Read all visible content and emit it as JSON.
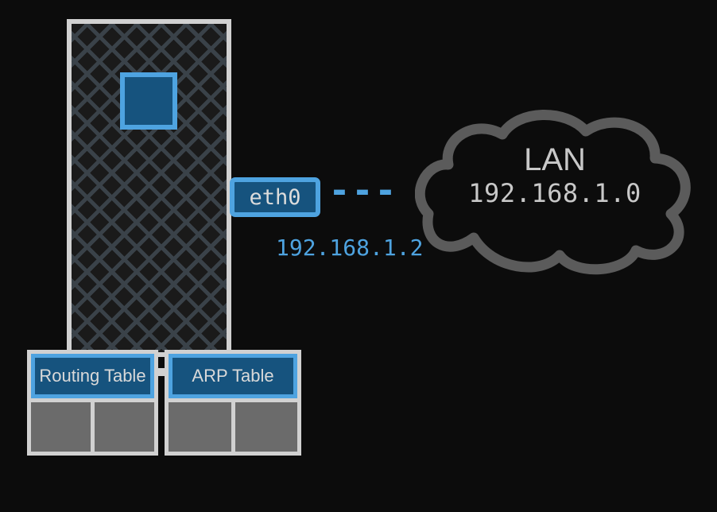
{
  "host": {
    "interface": {
      "name": "eth0",
      "ip": "192.168.1.2"
    }
  },
  "lan": {
    "label": "LAN",
    "network": "192.168.1.0"
  },
  "tables": {
    "routing": {
      "title": "Routing Table"
    },
    "arp": {
      "title": "ARP Table"
    }
  }
}
